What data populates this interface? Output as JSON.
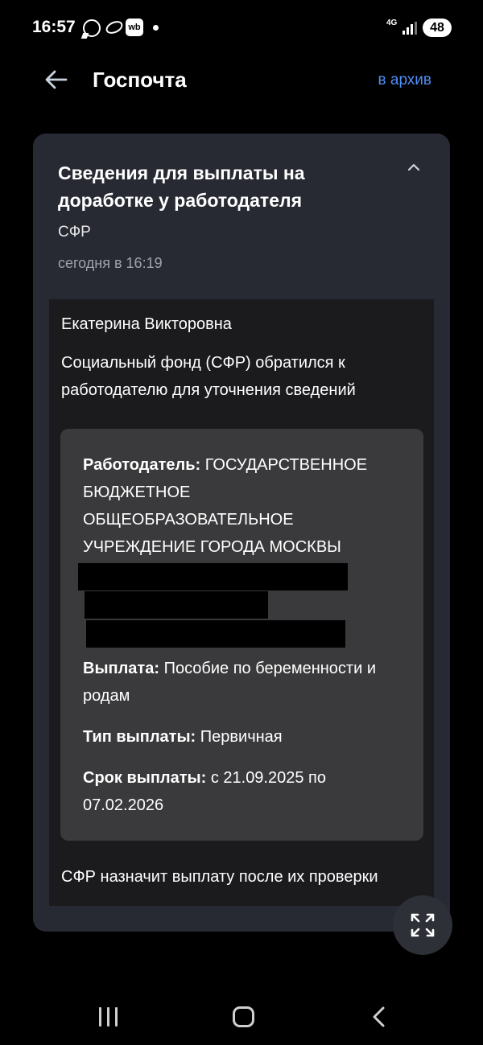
{
  "status_bar": {
    "time": "16:57",
    "icons": [
      "whatsapp-icon",
      "loop-icon",
      "wb-icon",
      "notification-dot-icon"
    ],
    "wb_label": "wb",
    "network": "4G",
    "battery": "48"
  },
  "header": {
    "title": "Госпочта",
    "archive_label": "в архив",
    "back_icon": "arrow-left-icon"
  },
  "message": {
    "title": "Сведения для выплаты на доработке у работодателя",
    "sender": "СФР",
    "date": "сегодня в 16:19",
    "greeting": "Екатерина Викторовна",
    "intro": "Социальный фонд (СФР) обратился к работодателю для уточнения сведений",
    "details": {
      "employer_label": "Работодатель:",
      "employer_value": "ГОСУДАРСТВЕННОЕ БЮДЖЕТНОЕ ОБЩЕОБРАЗОВАТЕЛЬНОЕ УЧРЕЖДЕНИЕ ГОРОДА МОСКВЫ",
      "payment_label": "Выплата:",
      "payment_value": "Пособие по беременности и родам",
      "type_label": "Тип выплаты:",
      "type_value": "Первичная",
      "term_label": "Срок выплаты:",
      "term_value": "с 21.09.2025 по 07.02.2026"
    },
    "closing": "СФР назначит выплату после их проверки"
  },
  "colors": {
    "background": "#000000",
    "card": "#282a33",
    "body": "#1b1b1e",
    "details_box": "#3a3a3c",
    "accent": "#4f8ff7",
    "muted": "#9ea3ad"
  },
  "nav_bar": {
    "icons": [
      "recent-apps-icon",
      "home-icon",
      "back-nav-icon"
    ]
  }
}
